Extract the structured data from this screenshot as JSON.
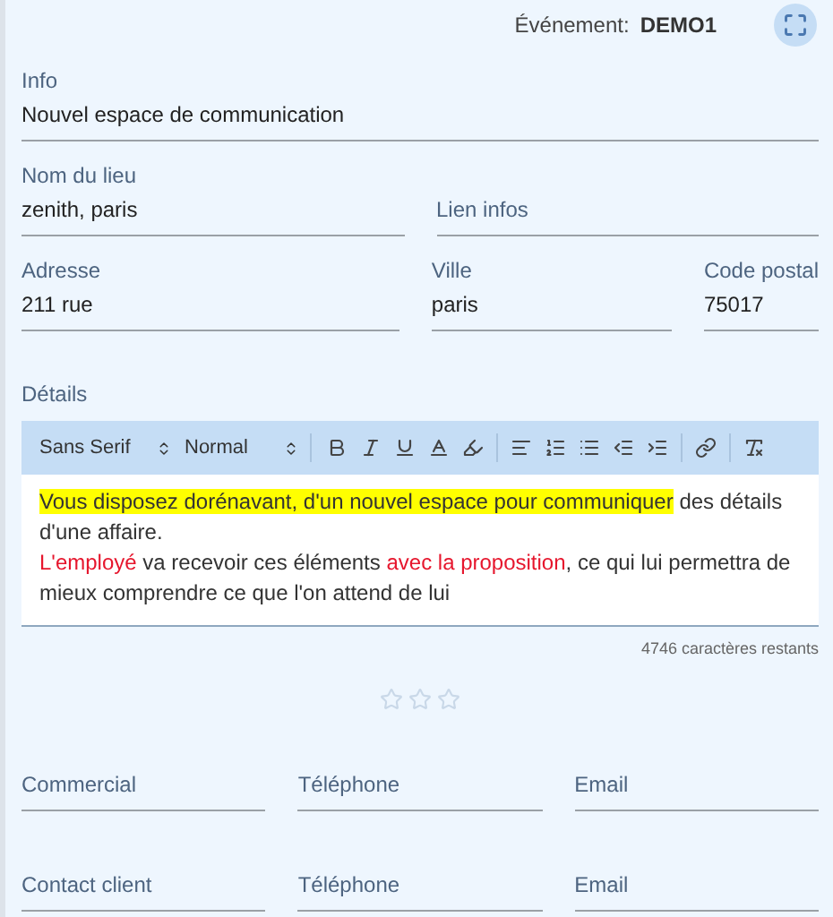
{
  "header": {
    "event_label": "Événement:",
    "event_value": "DEMO1"
  },
  "field_rows": [
    [
      {
        "label": "Info",
        "value": "Nouvel espace de communication"
      }
    ],
    [
      {
        "label": "Nom du lieu",
        "value": "zenith, paris"
      },
      {
        "label": "Lien infos"
      }
    ],
    [
      {
        "label": "Adresse",
        "value": "211 rue"
      },
      {
        "label": "Ville",
        "value": "paris"
      },
      {
        "label": "Code postal",
        "value": "75017"
      }
    ]
  ],
  "details": {
    "label": "Détails",
    "toolbar": {
      "font": "Sans Serif",
      "size": "Normal"
    },
    "paragraphs": [
      [
        {
          "kind": "highlight",
          "text": "Vous disposez dorénavant, d'un nouvel espace pour communiquer"
        },
        {
          "kind": "plain",
          "text": " des détails d'une affaire."
        }
      ],
      [
        {
          "kind": "red",
          "text": "L'employé"
        },
        {
          "kind": "plain",
          "text": " va recevoir ces éléments "
        },
        {
          "kind": "red",
          "text": "avec la proposition"
        },
        {
          "kind": "plain",
          "text": ", ce qui lui permettra de mieux comprendre ce que l'on attend de lui"
        }
      ]
    ],
    "counter": "4746 caractères restants"
  },
  "rating": {
    "stars": 0
  },
  "contact_rows": [
    [
      {
        "label": "Commercial"
      },
      {
        "label": "Téléphone"
      },
      {
        "label": "Email"
      }
    ],
    [
      {
        "label": "Contact client"
      },
      {
        "label": "Téléphone"
      },
      {
        "label": "Email"
      }
    ]
  ]
}
